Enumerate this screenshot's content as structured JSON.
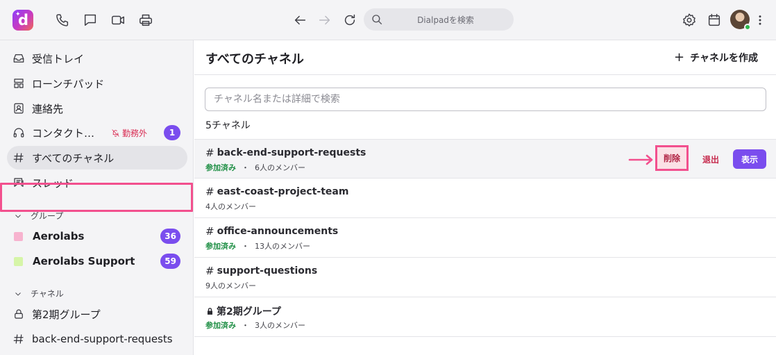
{
  "topbar": {
    "search_placeholder": "Dialpadを検索",
    "icons": [
      "dialpad-logo",
      "phone-icon",
      "chat-icon",
      "video-icon",
      "fax-icon",
      "back-icon",
      "forward-icon",
      "reload-icon",
      "search-icon",
      "settings-icon",
      "calendar-icon",
      "avatar",
      "more-icon"
    ]
  },
  "sidebar": {
    "items": [
      {
        "label": "受信トレイ",
        "icon": "inbox-icon"
      },
      {
        "label": "ローンチパッド",
        "icon": "launchpad-icon"
      },
      {
        "label": "連絡先",
        "icon": "contacts-icon"
      },
      {
        "label": "コンタクト…",
        "icon": "headset-icon",
        "status": "勤務外",
        "badge": "1"
      },
      {
        "label": "すべてのチャネル",
        "icon": "hash-icon",
        "active": true
      },
      {
        "label": "スレッド",
        "icon": "threads-icon"
      }
    ],
    "groups_header": "グループ",
    "groups": [
      {
        "label": "Aerolabs",
        "color": "#f7b3cf",
        "badge": "36"
      },
      {
        "label": "Aerolabs Support",
        "color": "#d6f5a8",
        "badge": "59"
      }
    ],
    "channels_header": "チャネル",
    "channels": [
      {
        "label": "第2期グループ",
        "icon": "lock-icon"
      },
      {
        "label": "back-end-support-requests",
        "icon": "hash-icon"
      }
    ]
  },
  "main": {
    "title": "すべてのチャネル",
    "create_label": "チャネルを作成",
    "filter_placeholder": "チャネル名または詳細で検索",
    "count_label": "5チャネル",
    "channels": [
      {
        "name": "back-end-support-requests",
        "joined": "参加済み",
        "members": "6人のメンバー",
        "private": false
      },
      {
        "name": "east-coast-project-team",
        "joined": "",
        "members": "4人のメンバー",
        "private": false
      },
      {
        "name": "office-announcements",
        "joined": "参加済み",
        "members": "13人のメンバー",
        "private": false
      },
      {
        "name": "support-questions",
        "joined": "",
        "members": "9人のメンバー",
        "private": false
      },
      {
        "name": "第2期グループ",
        "joined": "参加済み",
        "members": "3人のメンバー",
        "private": true
      }
    ],
    "actions": {
      "delete": "削除",
      "leave": "退出",
      "view": "表示"
    },
    "separator": "・"
  },
  "colors": {
    "accent": "#7a4dee",
    "highlight": "#f2508e",
    "joined": "#1f8f45",
    "danger": "#c62a4d"
  }
}
